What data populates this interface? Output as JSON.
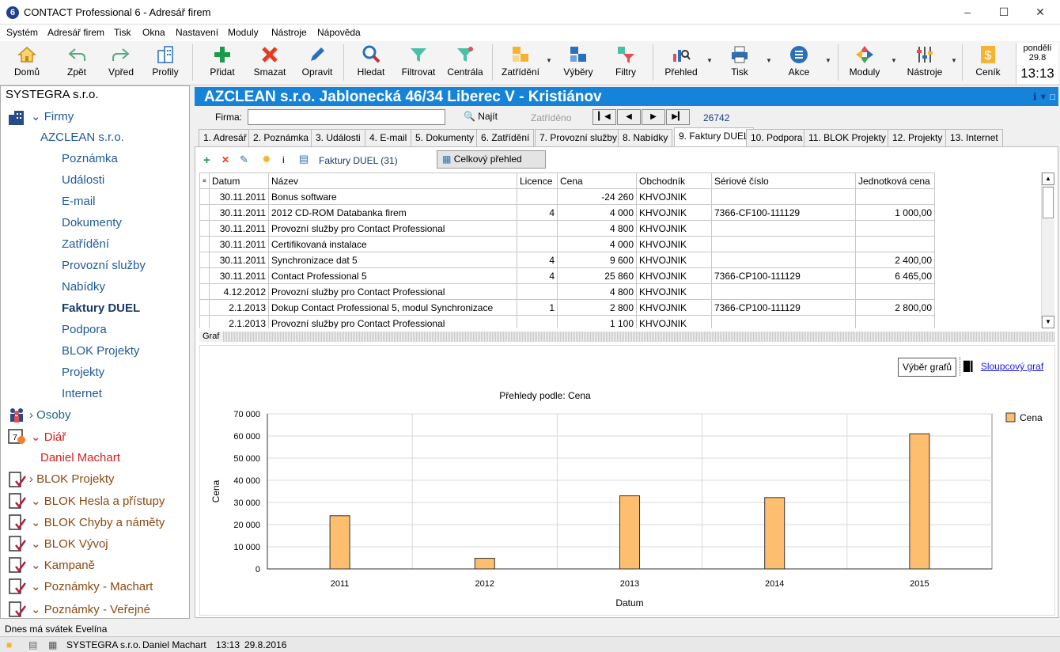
{
  "window": {
    "title": "CONTACT Professional 6 - Adresář firem",
    "logo": "6"
  },
  "menu": [
    "Systém",
    "Adresář firem",
    "Tisk",
    "Okna",
    "Nastavení",
    "Moduly",
    "Nástroje",
    "Nápověda"
  ],
  "toolbar": {
    "home": "Domů",
    "back": "Zpět",
    "forward": "Vpřed",
    "profiles": "Profily",
    "add": "Přidat",
    "delete": "Smazat",
    "edit": "Opravit",
    "search": "Hledat",
    "filter": "Filtrovat",
    "central": "Centrála",
    "classify": "Zatřídění",
    "selections": "Výběry",
    "filters": "Filtry",
    "overview": "Přehled",
    "print": "Tisk",
    "actions": "Akce",
    "modules": "Moduly",
    "tools": "Nástroje",
    "pricelist": "Ceník"
  },
  "clock": {
    "day": "pondělí",
    "date": "29.8",
    "time": "13:13"
  },
  "sidebar": {
    "company": "SYSTEGRA s.r.o.",
    "firms": "Firmy",
    "firm_name": "AZCLEAN s.r.o.",
    "subitems": [
      "Poznámka",
      "Události",
      "E-mail",
      "Dokumenty",
      "Zatřídění",
      "Provozní služby",
      "Nabídky",
      "Faktury DUEL",
      "Podpora",
      "BLOK Projekty",
      "Projekty",
      "Internet"
    ],
    "persons": "Osoby",
    "diary": "Diář",
    "diary_user": "Daniel Machart",
    "blocks": [
      "BLOK Projekty",
      "BLOK Hesla a přístupy",
      "BLOK Chyby a náměty",
      "BLOK Vývoj",
      "Kampaně",
      "Poznámky - Machart",
      "Poznámky - Veřejné"
    ]
  },
  "header": {
    "title": "AZCLEAN s.r.o. Jablonecká 46/34 Liberec V - Kristiánov"
  },
  "firmabar": {
    "label": "Firma:",
    "find": "Najít",
    "classify": "Zatříděno",
    "record": "26742"
  },
  "tabs": [
    "1. Adresář",
    "2. Poznámka",
    "3. Události",
    "4. E-mail",
    "5. Dokumenty",
    "6. Zatřídění",
    "7. Provozní služby",
    "8. Nabídky",
    "9. Faktury DUEL",
    "10. Podpora",
    "11. BLOK Projekty",
    "12. Projekty",
    "13. Internet"
  ],
  "gridbar": {
    "title": "Faktury DUEL (31)",
    "overview": "Celkový přehled"
  },
  "table": {
    "headers": [
      "Datum",
      "Název",
      "Licence",
      "Cena",
      "Obchodník",
      "Sériové číslo",
      "Jednotková cena"
    ],
    "rows": [
      [
        "30.11.2011",
        "Bonus software",
        "",
        "-24 260",
        "KHVOJNIK",
        "",
        ""
      ],
      [
        "30.11.2011",
        "2012 CD-ROM Databanka firem",
        "4",
        "4 000",
        "KHVOJNIK",
        "7366-CF100-111129",
        "1 000,00"
      ],
      [
        "30.11.2011",
        "Provozní služby pro Contact Professional",
        "",
        "4 800",
        "KHVOJNIK",
        "",
        ""
      ],
      [
        "30.11.2011",
        "Certifikovaná instalace",
        "",
        "4 000",
        "KHVOJNIK",
        "",
        ""
      ],
      [
        "30.11.2011",
        "Synchronizace dat 5",
        "4",
        "9 600",
        "KHVOJNIK",
        "",
        "2 400,00"
      ],
      [
        "30.11.2011",
        "Contact Professional 5",
        "4",
        "25 860",
        "KHVOJNIK",
        "7366-CP100-111129",
        "6 465,00"
      ],
      [
        "4.12.2012",
        "Provozní služby pro Contact Professional",
        "",
        "4 800",
        "KHVOJNIK",
        "",
        ""
      ],
      [
        "2.1.2013",
        "Dokup Contact Professional 5, modul Synchronizace",
        "1",
        "2 800",
        "KHVOJNIK",
        "7366-CP100-111129",
        "2 800,00"
      ],
      [
        "2.1.2013",
        "Provozní služby pro Contact Professional",
        "",
        "1 100",
        "KHVOJNIK",
        "",
        ""
      ]
    ]
  },
  "graph": {
    "label": "Graf",
    "select_btn": "Výběr grafů",
    "bar_link": "Sloupcový graf"
  },
  "chart_data": {
    "type": "bar",
    "title": "Přehledy podle: Cena",
    "xlabel": "Datum",
    "ylabel": "Cena",
    "categories": [
      "2011",
      "2012",
      "2013",
      "2014",
      "2015"
    ],
    "series": [
      {
        "name": "Cena",
        "values": [
          24000,
          4800,
          33000,
          32200,
          61000
        ]
      }
    ],
    "ylim": [
      0,
      70000
    ],
    "yticks": [
      "0",
      "10 000",
      "20 000",
      "30 000",
      "40 000",
      "50 000",
      "60 000",
      "70 000"
    ],
    "bar_color": "#fdbf6f",
    "grid": true,
    "legend": "right"
  },
  "statusline": "Dnes má svátek Evelína",
  "statusbar": {
    "company": "SYSTEGRA s.r.o.",
    "user": "Daniel Machart",
    "time": "13:13",
    "date": "29.8.2016"
  }
}
